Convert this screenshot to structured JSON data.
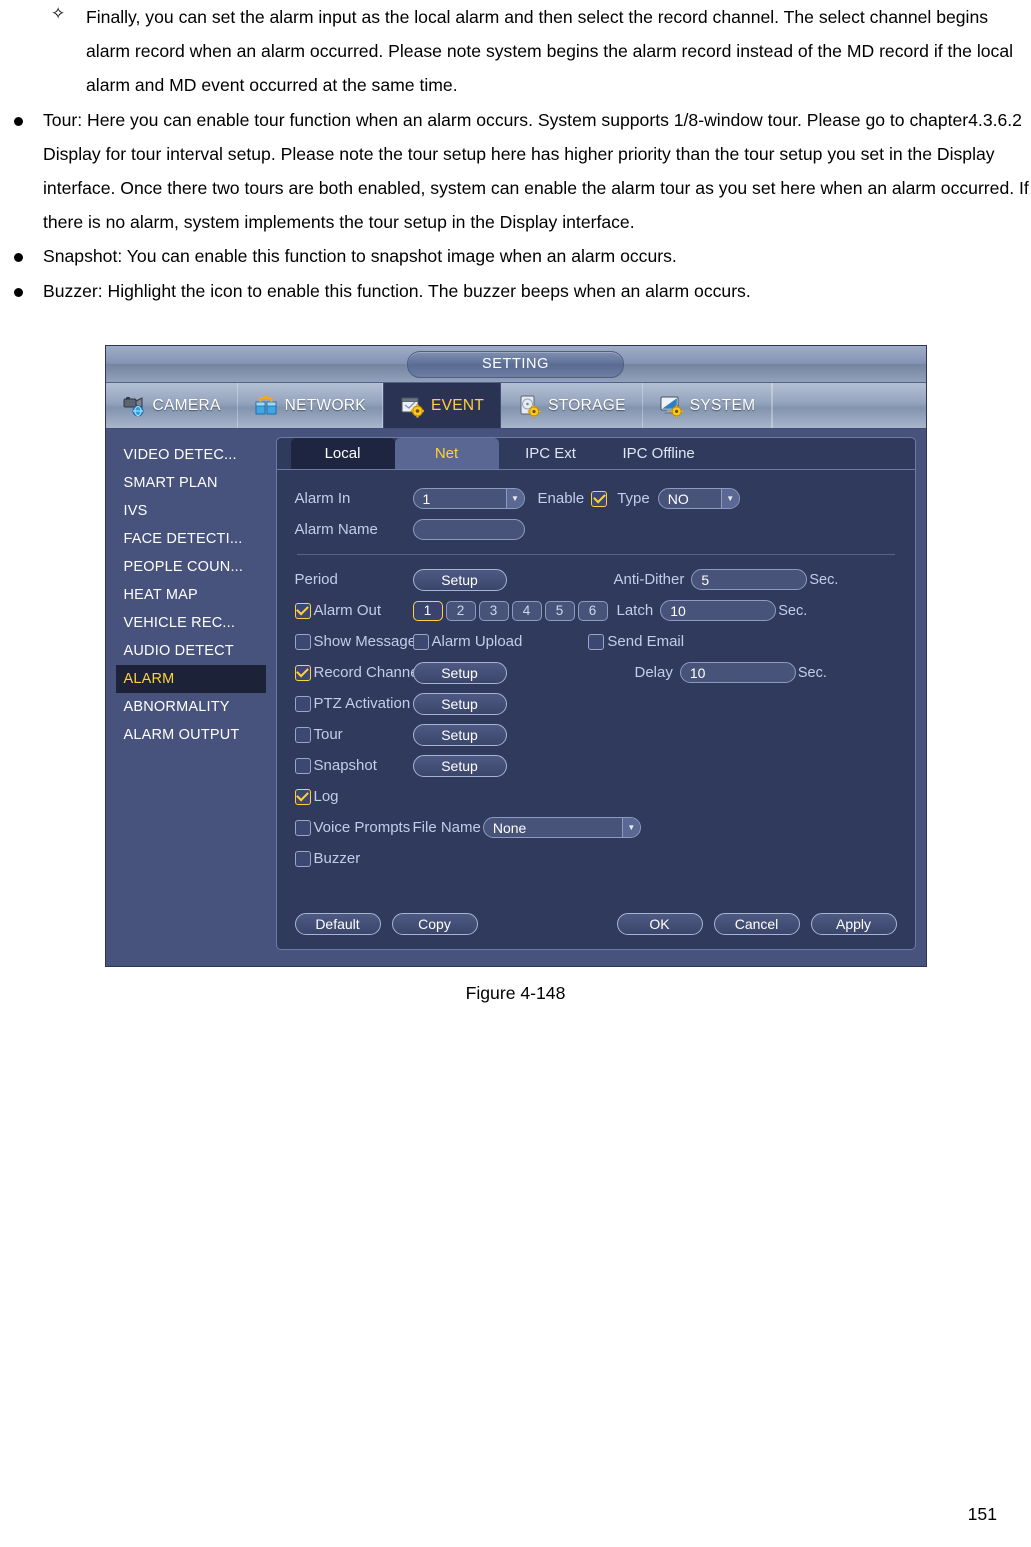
{
  "document": {
    "paragraphs": [
      {
        "level": 2,
        "text": "Finally, you can set the alarm input as the local alarm and then select the record channel. The select channel begins alarm record when an alarm occurred. Please note system begins the alarm record instead of the MD record if the local alarm and MD event occurred at the same time."
      },
      {
        "level": 1,
        "text": "Tour: Here you can enable tour function when an alarm occurs. System supports 1/8-window tour. Please go to chapter4.3.6.2 Display for tour interval setup. Please note the tour setup here has higher priority than the tour setup you set in the Display interface. Once there two tours are both enabled, system can enable the alarm tour as you set here when an alarm occurred. If there is no alarm, system implements the tour setup in the Display interface."
      },
      {
        "level": 1,
        "text": "Snapshot: You can enable this function to snapshot image when an alarm occurs."
      },
      {
        "level": 1,
        "text": "Buzzer: Highlight the icon to enable this function. The buzzer beeps when an alarm occurs."
      }
    ],
    "figure_caption": "Figure 4-148",
    "page_number": "151"
  },
  "nvr": {
    "title": "SETTING",
    "main_tabs": [
      {
        "label": "CAMERA",
        "icon": "camera-icon",
        "selected": false
      },
      {
        "label": "NETWORK",
        "icon": "network-icon",
        "selected": false
      },
      {
        "label": "EVENT",
        "icon": "event-icon",
        "selected": true
      },
      {
        "label": "STORAGE",
        "icon": "storage-icon",
        "selected": false
      },
      {
        "label": "SYSTEM",
        "icon": "system-icon",
        "selected": false
      }
    ],
    "sidebar": {
      "items": [
        {
          "label": "VIDEO DETEC...",
          "selected": false
        },
        {
          "label": "SMART PLAN",
          "selected": false
        },
        {
          "label": "IVS",
          "selected": false
        },
        {
          "label": "FACE DETECTI...",
          "selected": false
        },
        {
          "label": "PEOPLE COUN...",
          "selected": false
        },
        {
          "label": "HEAT MAP",
          "selected": false
        },
        {
          "label": "VEHICLE REC...",
          "selected": false
        },
        {
          "label": "AUDIO DETECT",
          "selected": false
        },
        {
          "label": "ALARM",
          "selected": true
        },
        {
          "label": "ABNORMALITY",
          "selected": false
        },
        {
          "label": "ALARM OUTPUT",
          "selected": false
        }
      ]
    },
    "sub_tabs": [
      {
        "label": "Local",
        "state": "selected"
      },
      {
        "label": "Net",
        "state": "alt"
      },
      {
        "label": "IPC Ext",
        "state": "normal"
      },
      {
        "label": "IPC Offline",
        "state": "normal"
      }
    ],
    "form": {
      "alarm_in_label": "Alarm In",
      "alarm_in_value": "1",
      "enable_label": "Enable",
      "enable_checked": true,
      "type_label": "Type",
      "type_value": "NO",
      "alarm_name_label": "Alarm Name",
      "alarm_name_value": "",
      "alarm_name_placeholder": "",
      "period_label": "Period",
      "period_setup": "Setup",
      "anti_dither_label": "Anti-Dither",
      "anti_dither_value": "5",
      "anti_dither_unit": "Sec.",
      "alarm_out_label": "Alarm Out",
      "alarm_out_checked": true,
      "alarm_out_channels": [
        "1",
        "2",
        "3",
        "4",
        "5",
        "6"
      ],
      "alarm_out_selected": "1",
      "latch_label": "Latch",
      "latch_value": "10",
      "latch_unit": "Sec.",
      "show_message_label": "Show Message",
      "show_message_checked": false,
      "alarm_upload_label": "Alarm Upload",
      "alarm_upload_checked": false,
      "send_email_label": "Send Email",
      "send_email_checked": false,
      "record_channel_label": "Record Channel",
      "record_channel_checked": true,
      "record_channel_setup": "Setup",
      "delay_label": "Delay",
      "delay_value": "10",
      "delay_unit": "Sec.",
      "ptz_label": "PTZ Activation",
      "ptz_checked": false,
      "ptz_setup": "Setup",
      "tour_label": "Tour",
      "tour_checked": false,
      "tour_setup": "Setup",
      "snapshot_label": "Snapshot",
      "snapshot_checked": false,
      "snapshot_setup": "Setup",
      "log_label": "Log",
      "log_checked": true,
      "voice_prompts_label": "Voice Prompts",
      "voice_prompts_checked": false,
      "file_name_label": "File Name",
      "file_name_value": "None",
      "buzzer_label": "Buzzer",
      "buzzer_checked": false
    },
    "buttons": {
      "default": "Default",
      "copy": "Copy",
      "ok": "OK",
      "cancel": "Cancel",
      "apply": "Apply"
    },
    "colors": {
      "accent_yellow": "#ffd23a",
      "panel_bg": "#303a5c",
      "frame_bg": "#48537d",
      "selected_tab_bg": "#2a3354",
      "label_blue": "#c3ccea"
    }
  }
}
